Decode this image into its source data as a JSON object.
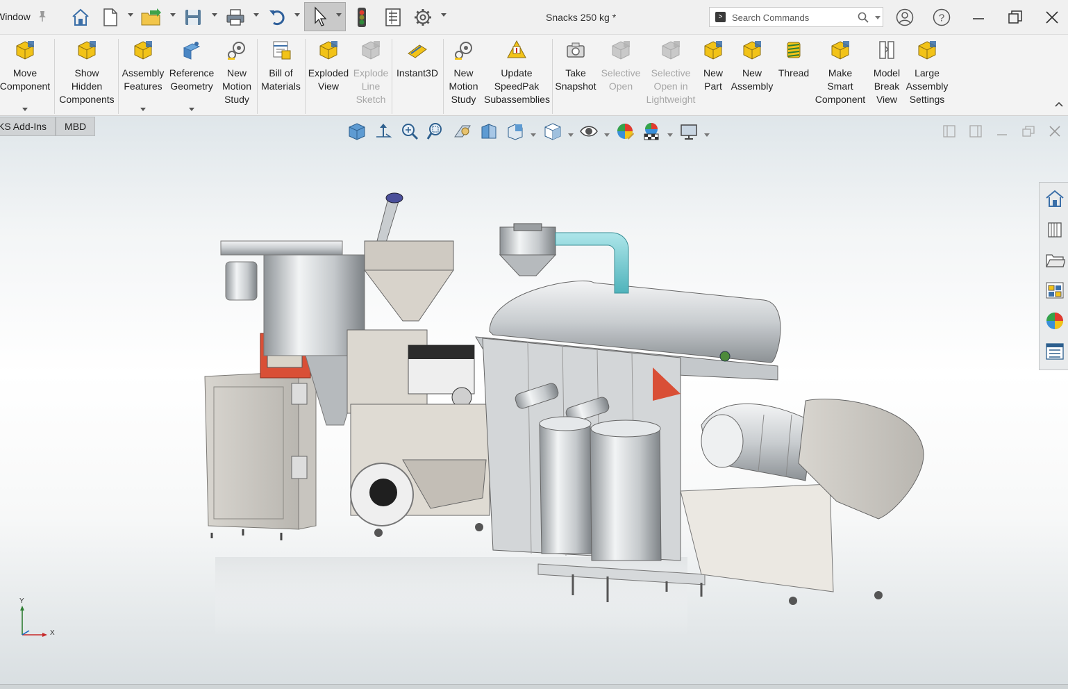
{
  "titlebar": {
    "menu_window": "Window",
    "document_title": "Snacks 250 kg *",
    "search": {
      "placeholder": "Search Commands"
    }
  },
  "ribbon": {
    "buttons": [
      {
        "label": "Move\nComponent",
        "icon": "move-component-icon",
        "enabled": true,
        "has_dropdown": true
      },
      {
        "label": "Show\nHidden\nComponents",
        "icon": "show-hidden-components-icon",
        "enabled": true
      },
      {
        "label": "Assembly\nFeatures",
        "icon": "assembly-features-icon",
        "enabled": true,
        "has_dropdown": true
      },
      {
        "label": "Reference\nGeometry",
        "icon": "reference-geometry-icon",
        "enabled": true,
        "has_dropdown": true
      },
      {
        "label": "New\nMotion\nStudy",
        "icon": "new-motion-study-icon",
        "enabled": true
      },
      {
        "label": "Bill of\nMaterials",
        "icon": "bill-of-materials-icon",
        "enabled": true
      },
      {
        "label": "Exploded\nView",
        "icon": "exploded-view-icon",
        "enabled": true
      },
      {
        "label": "Explode\nLine\nSketch",
        "icon": "explode-line-sketch-icon",
        "enabled": false
      },
      {
        "label": "Instant3D",
        "icon": "instant3d-icon",
        "enabled": true
      },
      {
        "label": "New\nMotion\nStudy",
        "icon": "new-motion-study-icon",
        "enabled": true
      },
      {
        "label": "Update\nSpeedPak\nSubassemblies",
        "icon": "update-speedpak-icon",
        "enabled": true
      },
      {
        "label": "Take\nSnapshot",
        "icon": "take-snapshot-icon",
        "enabled": true
      },
      {
        "label": "Selective\nOpen",
        "icon": "selective-open-icon",
        "enabled": false
      },
      {
        "label": "Selective\nOpen in\nLightweight",
        "icon": "selective-open-lightweight-icon",
        "enabled": false
      },
      {
        "label": "New\nPart",
        "icon": "new-part-icon",
        "enabled": true
      },
      {
        "label": "New\nAssembly",
        "icon": "new-assembly-icon",
        "enabled": true
      },
      {
        "label": "Thread",
        "icon": "thread-icon",
        "enabled": true
      },
      {
        "label": "Make\nSmart\nComponent",
        "icon": "make-smart-component-icon",
        "enabled": true
      },
      {
        "label": "Model\nBreak\nView",
        "icon": "model-break-view-icon",
        "enabled": true
      },
      {
        "label": "Large\nAssembly\nSettings",
        "icon": "large-assembly-settings-icon",
        "enabled": true
      }
    ]
  },
  "viewport": {
    "tabs": [
      "KS Add-Ins",
      "MBD"
    ],
    "triad": {
      "x": "X",
      "y": "Y"
    }
  },
  "colors": {
    "accent_gold": "#f2c318",
    "accent_red": "#d03a2a",
    "pipe_cyan": "#6cc9cf",
    "steel": "#bfc3c6"
  }
}
